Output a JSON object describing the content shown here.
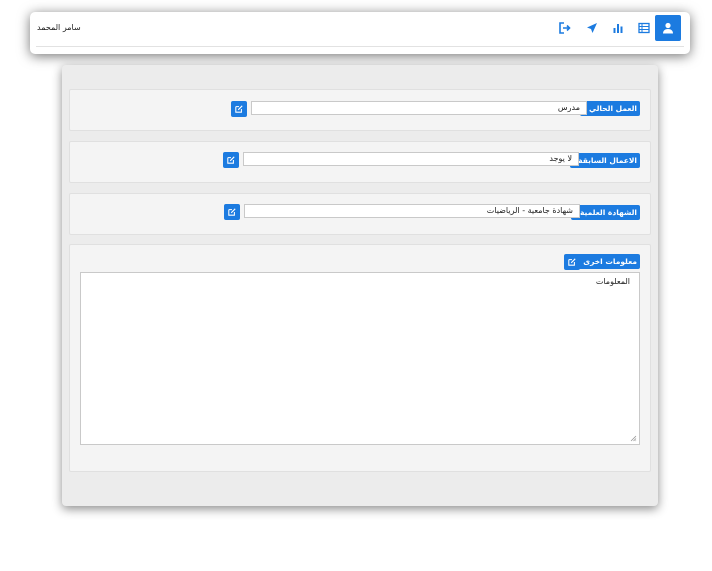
{
  "header": {
    "user_name": "سامر المحمد",
    "icons": [
      "profile-icon",
      "table-icon",
      "chart-icon",
      "send-icon",
      "logout-icon"
    ],
    "accent": "#1c7be0"
  },
  "form": {
    "current_job": {
      "label": "العمل الحالي :",
      "value": "مدرس"
    },
    "previous_jobs": {
      "label": "الاعمال السابقة :",
      "value": "لا يوجد"
    },
    "degree": {
      "label": "الشهادة العلمية :",
      "value": "شهادة جامعية -  الرياضيات"
    },
    "other_info": {
      "label": "معلومات اخرى :",
      "value": "المعلومات"
    }
  }
}
